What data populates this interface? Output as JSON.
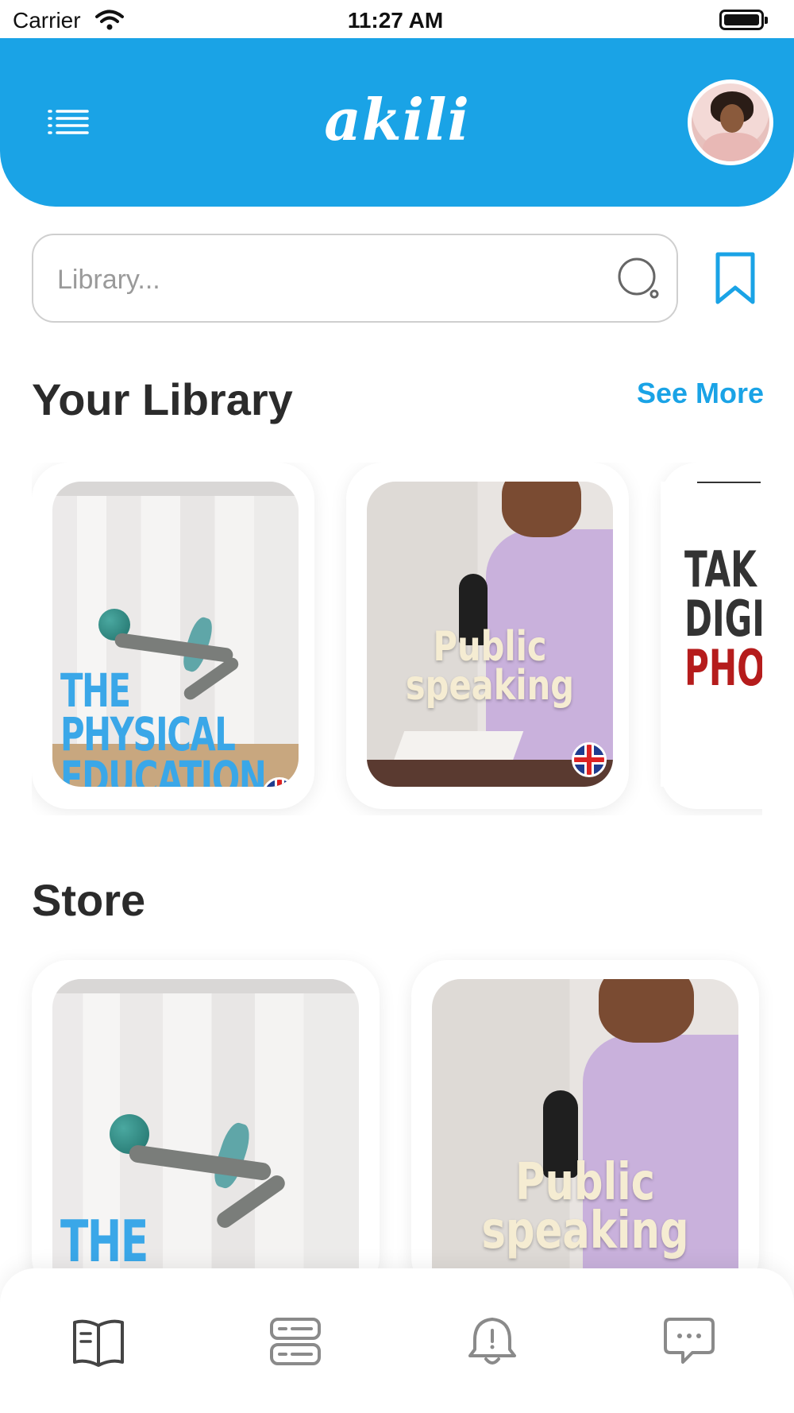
{
  "status_bar": {
    "carrier": "Carrier",
    "time": "11:27 AM"
  },
  "header": {
    "logo": "akili"
  },
  "search": {
    "placeholder": "Library..."
  },
  "library": {
    "title": "Your Library",
    "see_more": "See More",
    "books": [
      {
        "title_lines": [
          "THE",
          "PHYSICAL",
          "EDUCATION"
        ],
        "flag": "uk-flag"
      },
      {
        "title_lines": [
          "Public",
          "speaking"
        ],
        "flag": "uk-flag"
      },
      {
        "title_lines": [
          "TAK",
          "DIGI",
          "PHO"
        ]
      }
    ]
  },
  "store": {
    "title": "Store",
    "books": [
      {
        "title_lines": [
          "THE"
        ]
      },
      {
        "title_lines": [
          "Public",
          "speaking"
        ]
      }
    ]
  },
  "bottom_nav": {
    "items": [
      {
        "icon": "book-icon",
        "active": true
      },
      {
        "icon": "list-icon",
        "active": false
      },
      {
        "icon": "bell-icon",
        "active": false
      },
      {
        "icon": "chat-icon",
        "active": false
      }
    ]
  },
  "colors": {
    "accent": "#1aa3e6",
    "text": "#2b2b2b",
    "muted": "#9a9a9a"
  }
}
